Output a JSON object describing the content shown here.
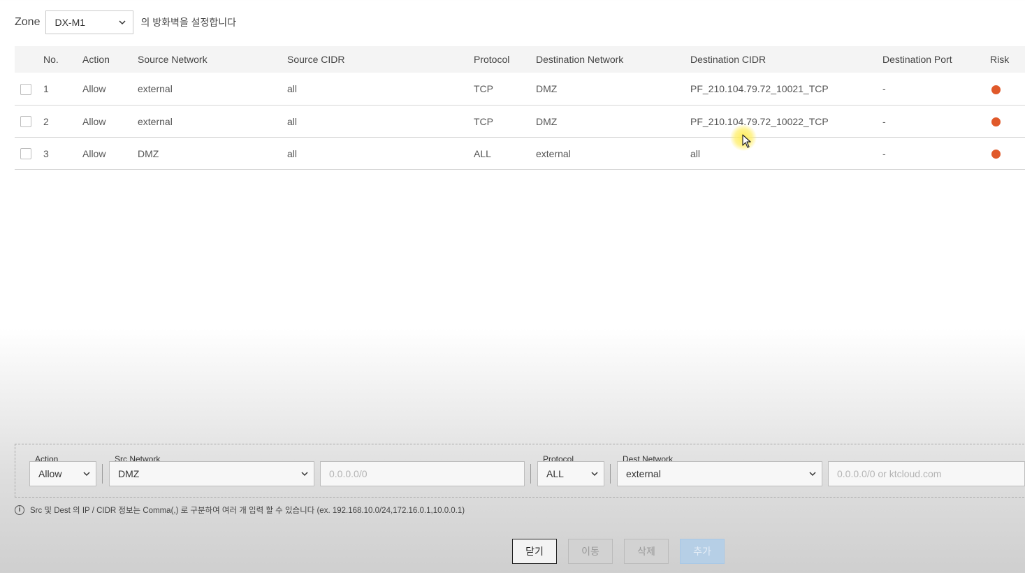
{
  "zone": {
    "label": "Zone",
    "selected": "DX-M1",
    "description": "의 방화벽을 설정합니다"
  },
  "table": {
    "headers": {
      "no": "No.",
      "action": "Action",
      "source_network": "Source Network",
      "source_cidr": "Source CIDR",
      "protocol": "Protocol",
      "destination_network": "Destination Network",
      "destination_cidr": "Destination CIDR",
      "destination_port": "Destination Port",
      "risk": "Risk"
    },
    "rows": [
      {
        "no": "1",
        "action": "Allow",
        "source_network": "external",
        "source_cidr": "all",
        "protocol": "TCP",
        "destination_network": "DMZ",
        "destination_cidr": "PF_210.104.79.72_10021_TCP",
        "destination_port": "-",
        "risk_color": "#e0592a"
      },
      {
        "no": "2",
        "action": "Allow",
        "source_network": "external",
        "source_cidr": "all",
        "protocol": "TCP",
        "destination_network": "DMZ",
        "destination_cidr": "PF_210.104.79.72_10022_TCP",
        "destination_port": "-",
        "risk_color": "#e0592a"
      },
      {
        "no": "3",
        "action": "Allow",
        "source_network": "DMZ",
        "source_cidr": "all",
        "protocol": "ALL",
        "destination_network": "external",
        "destination_cidr": "all",
        "destination_port": "-",
        "risk_color": "#e0592a"
      }
    ]
  },
  "form": {
    "action_label": "Action",
    "action_value": "Allow",
    "src_network_label": "Src Network",
    "src_network_value": "DMZ",
    "src_cidr_placeholder": "0.0.0.0/0",
    "protocol_label": "Protocol",
    "protocol_value": "ALL",
    "dest_network_label": "Dest Network",
    "dest_network_value": "external",
    "dest_cidr_placeholder": "0.0.0.0/0 or ktcloud.com"
  },
  "hint": {
    "icon": "info-icon",
    "text": "Src 및 Dest 의 IP / CIDR 정보는 Comma(,) 로 구분하여 여러 개 입력 할 수 있습니다 (ex. 192.168.10.0/24,172.16.0.1,10.0.0.1)"
  },
  "buttons": {
    "close": "닫기",
    "move": "이동",
    "delete": "삭제",
    "add": "추가"
  },
  "colors": {
    "risk": "#e0592a",
    "primary_disabled": "#b6cfe6"
  }
}
